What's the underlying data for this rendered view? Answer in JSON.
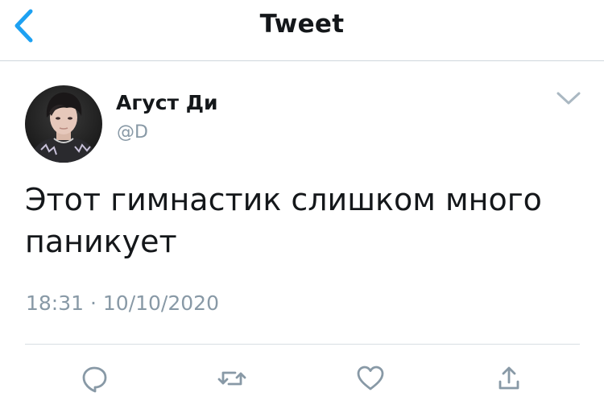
{
  "header": {
    "title": "Tweet",
    "back_icon": "chevron-left-icon"
  },
  "tweet": {
    "author": {
      "display_name": "Агуст Ди",
      "handle": "@D"
    },
    "text": "Этот гимнастик слишком много паникует",
    "timestamp": "18:31 · 10/10/2020",
    "menu_icon": "chevron-down-icon"
  },
  "actions": [
    {
      "icon": "reply-icon"
    },
    {
      "icon": "retweet-icon"
    },
    {
      "icon": "like-icon"
    },
    {
      "icon": "share-icon"
    }
  ],
  "colors": {
    "accent": "#1da1f2",
    "text": "#14171a",
    "secondary": "#8899a6",
    "divider": "#d8dee3"
  }
}
